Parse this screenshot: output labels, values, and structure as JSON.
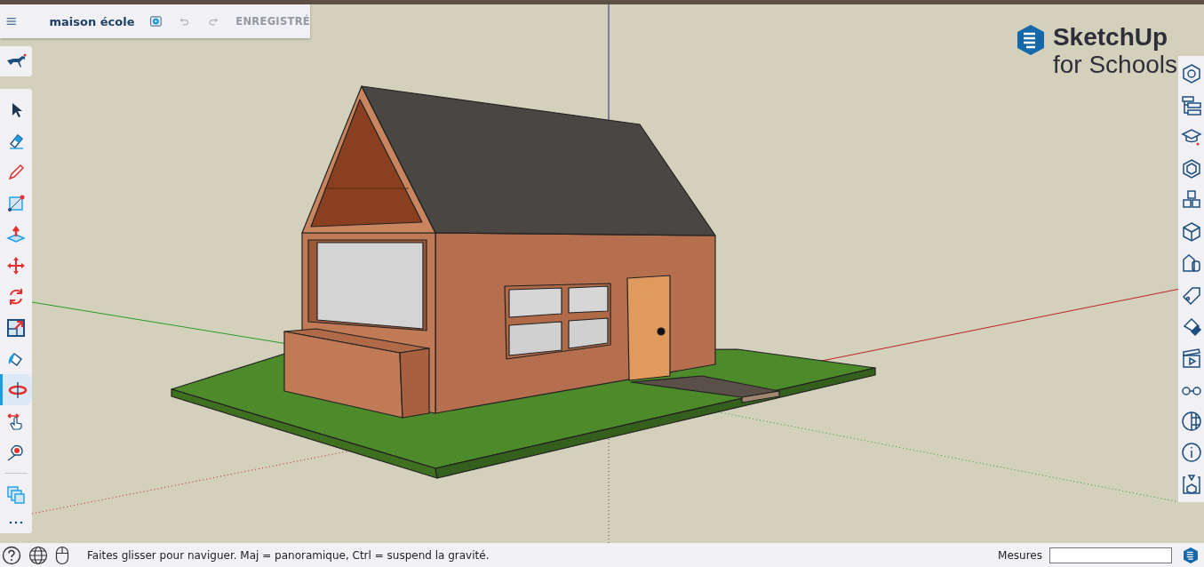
{
  "header": {
    "title": "maison école",
    "save_status": "ENREGISTRÉ"
  },
  "logo": {
    "name": "SketchUp",
    "subtitle": "for Schools"
  },
  "tools": [
    {
      "selected": false
    },
    {
      "selected": false
    },
    {
      "selected": false
    },
    {
      "selected": false
    },
    {
      "selected": false
    },
    {
      "selected": false
    },
    {
      "selected": false
    },
    {
      "selected": false
    },
    {
      "selected": false
    },
    {
      "selected": true
    },
    {
      "selected": false
    },
    {
      "selected": false
    },
    {
      "selected": false
    }
  ],
  "status_bar": {
    "hint": "Faites glisser pour naviguer. Maj = panoramique, Ctrl = suspend la gravité.",
    "measures_label": "Mesures"
  }
}
